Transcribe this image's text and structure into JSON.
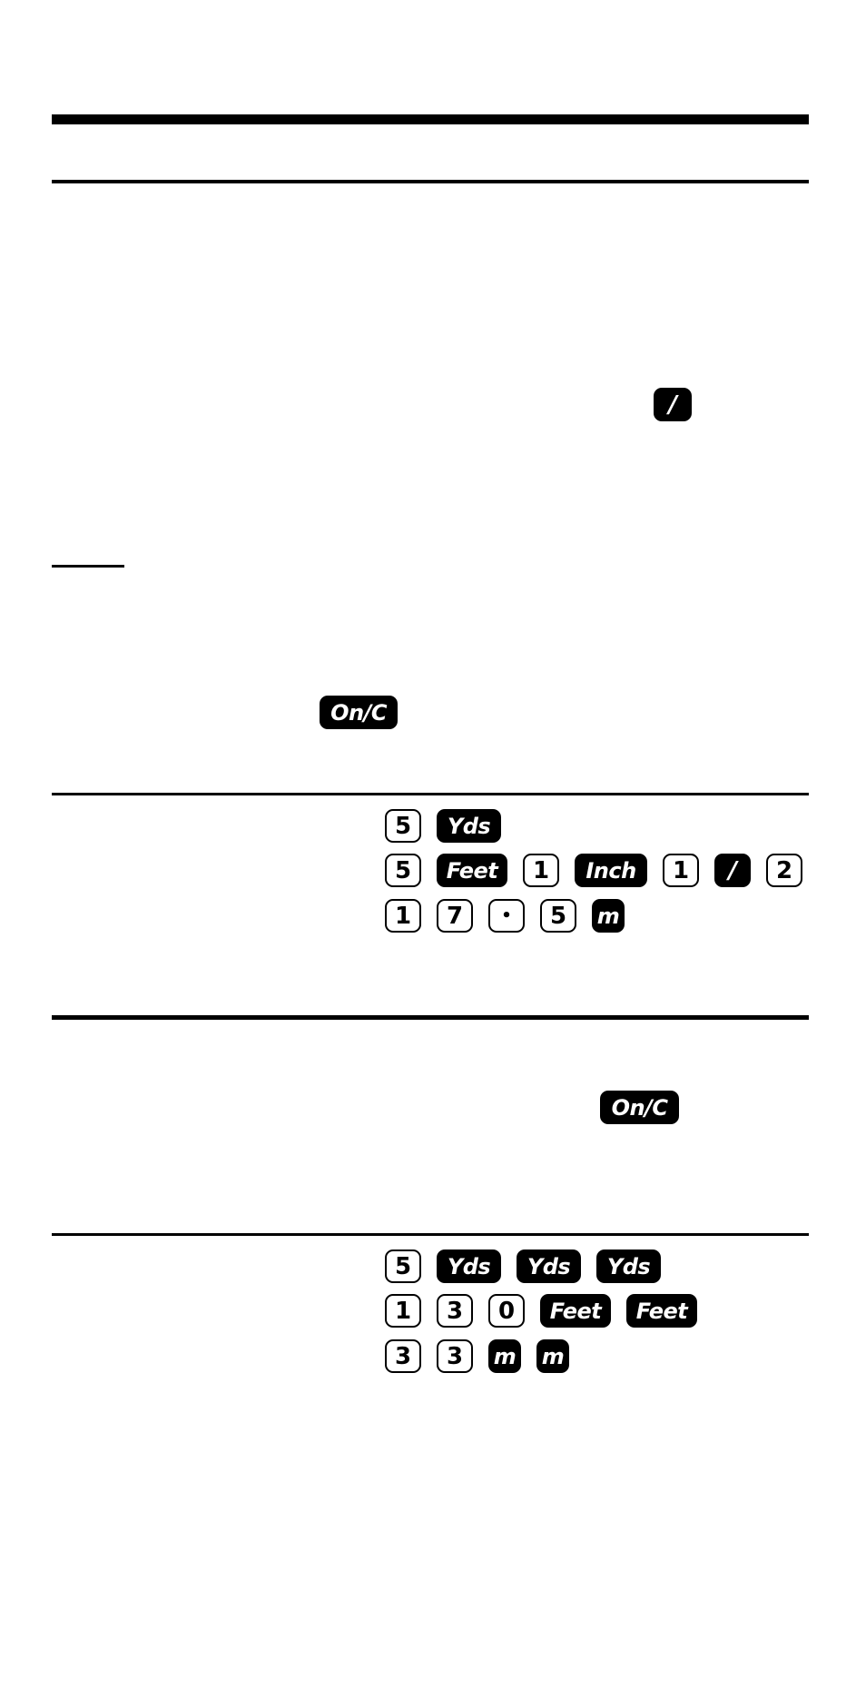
{
  "page": {
    "rules": [
      "header-thick",
      "header-thin",
      "note-underline",
      "example1-divider",
      "section-divider",
      "example2-divider"
    ]
  },
  "keys": {
    "fraction_key_intro": "/",
    "on_c_intro": "On/C",
    "on_c_section2": "On/C"
  },
  "example1": {
    "rows": [
      [
        {
          "label": "5",
          "type": "num"
        },
        {
          "label": "Yds",
          "type": "fn"
        }
      ],
      [
        {
          "label": "5",
          "type": "num"
        },
        {
          "label": "Feet",
          "type": "fn"
        },
        {
          "label": "1",
          "type": "num"
        },
        {
          "label": "Inch",
          "type": "fn"
        },
        {
          "label": "1",
          "type": "num"
        },
        {
          "label": "/",
          "type": "fn"
        },
        {
          "label": "2",
          "type": "num"
        }
      ],
      [
        {
          "label": "1",
          "type": "num"
        },
        {
          "label": "7",
          "type": "num"
        },
        {
          "label": "•",
          "type": "num"
        },
        {
          "label": "5",
          "type": "num"
        },
        {
          "label": "m",
          "type": "fn"
        }
      ]
    ]
  },
  "example2": {
    "rows": [
      [
        {
          "label": "5",
          "type": "num"
        },
        {
          "label": "Yds",
          "type": "fn"
        },
        {
          "label": "Yds",
          "type": "fn"
        },
        {
          "label": "Yds",
          "type": "fn"
        }
      ],
      [
        {
          "label": "1",
          "type": "num"
        },
        {
          "label": "3",
          "type": "num"
        },
        {
          "label": "0",
          "type": "num"
        },
        {
          "label": "Feet",
          "type": "fn"
        },
        {
          "label": "Feet",
          "type": "fn"
        }
      ],
      [
        {
          "label": "3",
          "type": "num"
        },
        {
          "label": "3",
          "type": "num"
        },
        {
          "label": "m",
          "type": "fn"
        },
        {
          "label": "m",
          "type": "fn"
        }
      ]
    ]
  }
}
